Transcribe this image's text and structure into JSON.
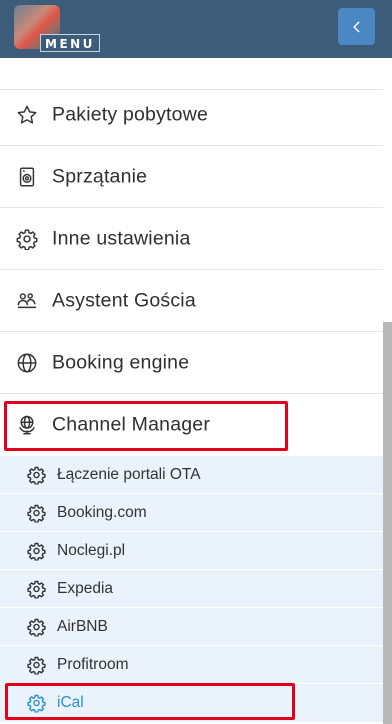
{
  "header": {
    "menu_label": "MENU",
    "back_icon": "chevron-left-icon",
    "colors": {
      "background": "#3d5c7a",
      "back_button": "#4a87c3"
    }
  },
  "menu": {
    "items": [
      {
        "label": "Pakiety pobytowe",
        "icon": "star-icon"
      },
      {
        "label": "Sprzątanie",
        "icon": "washing-machine-icon"
      },
      {
        "label": "Inne ustawienia",
        "icon": "gear-icon"
      },
      {
        "label": "Asystent Gościa",
        "icon": "people-icon"
      },
      {
        "label": "Booking engine",
        "icon": "globe-icon"
      },
      {
        "label": "Channel Manager",
        "icon": "globe-stand-icon"
      }
    ],
    "subitems": [
      {
        "label": "Łączenie portali OTA",
        "icon": "gear-icon"
      },
      {
        "label": "Booking.com",
        "icon": "gear-icon"
      },
      {
        "label": "Noclegi.pl",
        "icon": "gear-icon"
      },
      {
        "label": "Expedia",
        "icon": "gear-icon"
      },
      {
        "label": "AirBNB",
        "icon": "gear-icon"
      },
      {
        "label": "Profitroom",
        "icon": "gear-icon"
      },
      {
        "label": "iCal",
        "icon": "gear-icon",
        "active": true
      }
    ]
  },
  "colors": {
    "highlight": "#e3001b",
    "active_link": "#2b8fd1",
    "submenu_bg": "#eaf3fb"
  }
}
